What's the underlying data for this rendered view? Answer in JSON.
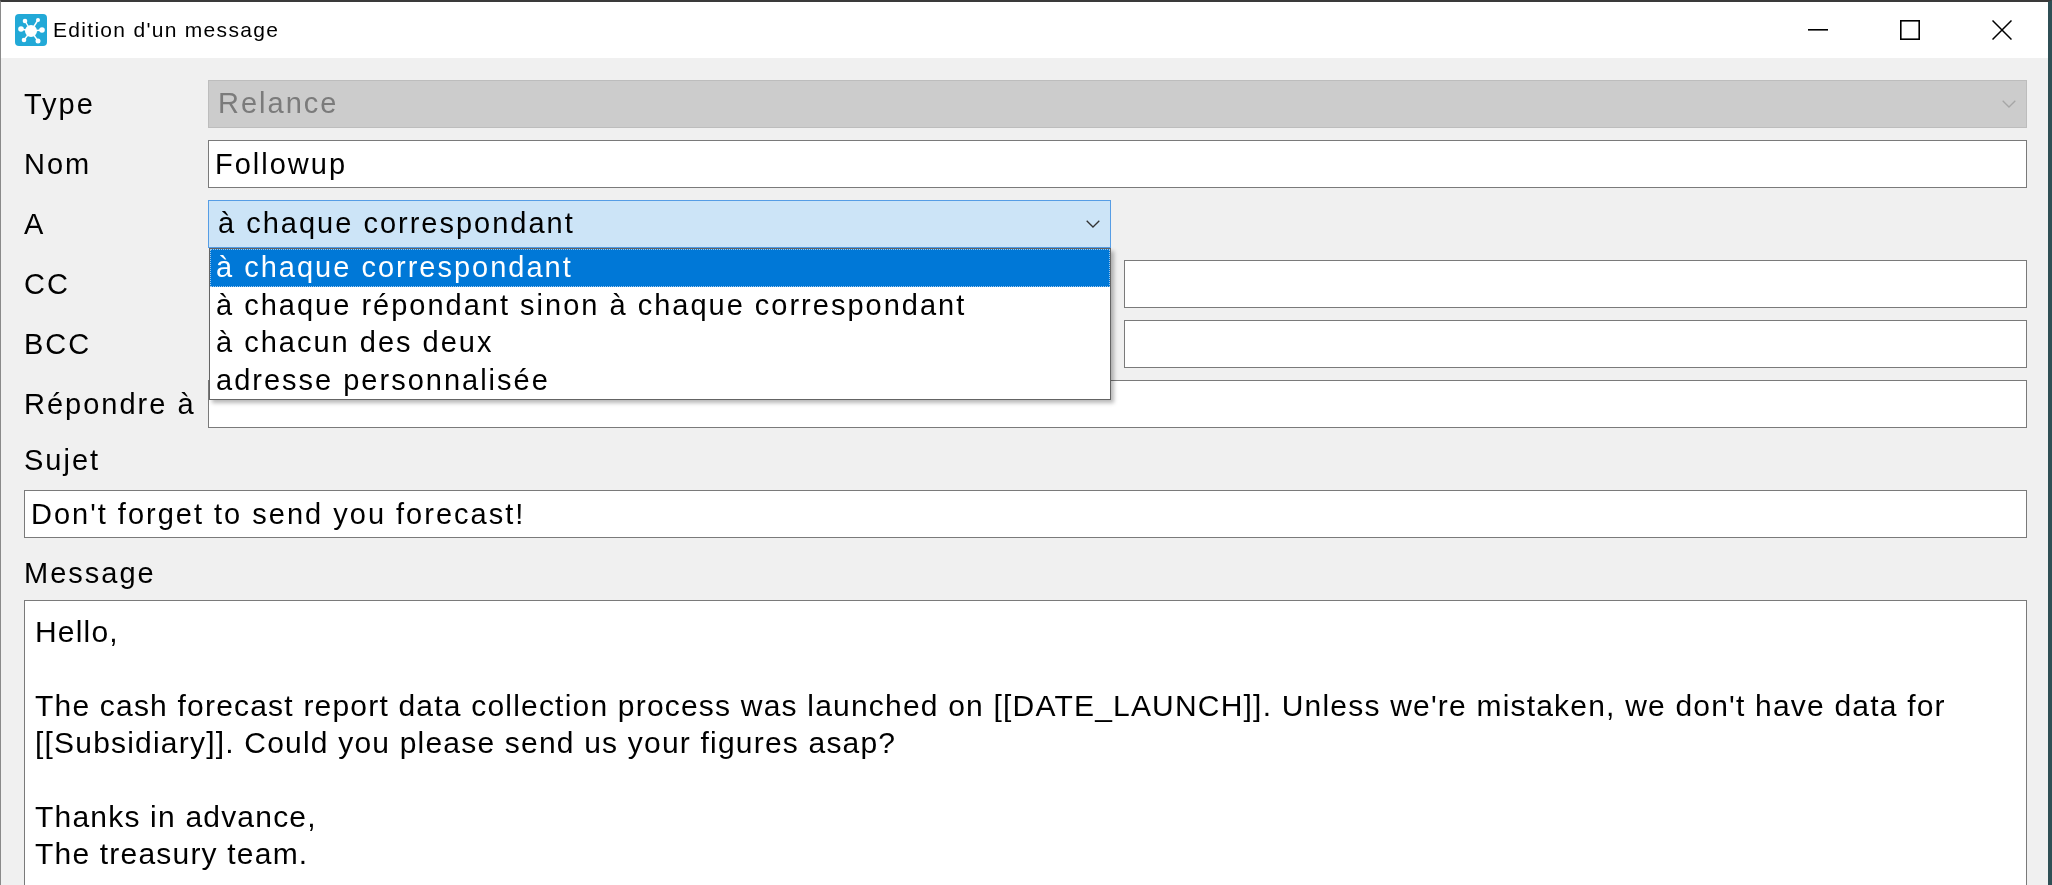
{
  "window": {
    "title": "Edition d'un message"
  },
  "form": {
    "rows": [
      {
        "kind": "select",
        "label": "Type",
        "select": {
          "value": "Relance",
          "disabled": true
        }
      },
      {
        "kind": "text",
        "label": "Nom",
        "value": "Followup"
      },
      {
        "kind": "recipient",
        "label": "A",
        "select": {
          "value": "à chaque correspondant",
          "expanded": true,
          "options": [
            {
              "label": "à chaque correspondant",
              "selected": true
            },
            {
              "label": "à chaque répondant sinon à chaque correspondant",
              "selected": false
            },
            {
              "label": "à chacun des deux",
              "selected": false
            },
            {
              "label": "adresse personnalisée",
              "selected": false
            }
          ]
        }
      },
      {
        "kind": "recipient",
        "label": "CC",
        "address_field": true
      },
      {
        "kind": "recipient",
        "label": "BCC",
        "address_field": true
      },
      {
        "kind": "text",
        "label": "Répondre à"
      }
    ],
    "subject": {
      "label": "Sujet",
      "value": "Don't forget to send you forecast!"
    },
    "message": {
      "label": "Message",
      "paragraphs": [
        [
          "Hello,"
        ],
        [
          "The cash forecast report data collection process was launched on [[DATE_LAUNCH]]. Unless we're mistaken, we don't have data for [[Subsidiary]]. Could you please send us your figures asap?"
        ],
        [
          "Thanks in advance,",
          "The treasury team."
        ]
      ]
    }
  }
}
